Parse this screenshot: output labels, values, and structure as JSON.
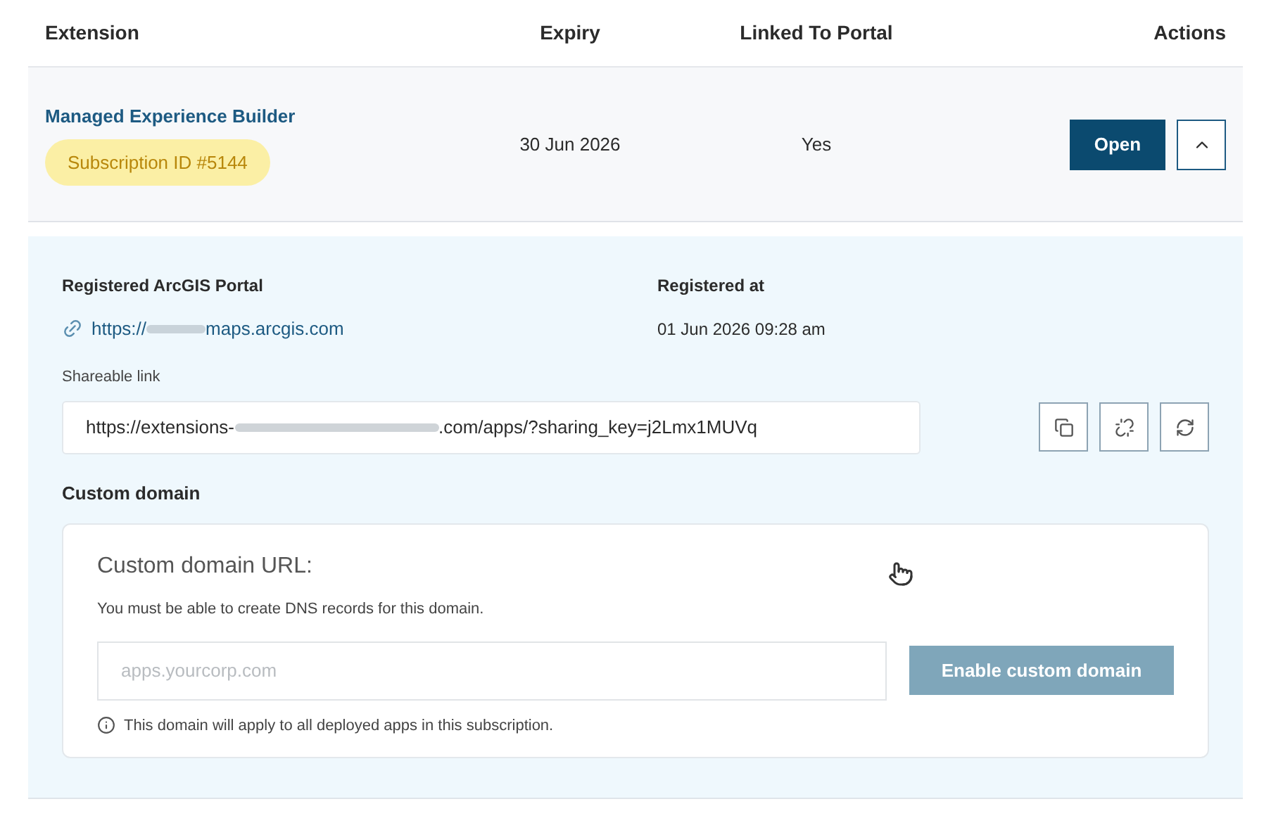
{
  "table": {
    "columns": [
      "Extension",
      "Expiry",
      "Linked To Portal",
      "Actions"
    ],
    "rows": [
      {
        "name": "Managed Experience Builder",
        "subscription": "Subscription ID #5144",
        "expiry": "30 Jun 2026",
        "linked": "Yes",
        "open_button": "Open",
        "expanded": true,
        "details": {
          "portal_label": "Registered ArcGIS Portal",
          "portal_url_start": "https://",
          "portal_url_end": "maps.arcgis.com",
          "registered_label": "Registered at",
          "registered_value": "01 Jun 2026 09:28 am",
          "share_label": "Shareable link",
          "share_url_start": "https://extensions-",
          "share_url_end": ".com/apps/?sharing_key=j2Lmx1MUVq",
          "custom_domain_title": "Custom domain",
          "custom_domain": {
            "heading": "Custom domain URL:",
            "hint": "You must be able to create DNS records for this domain.",
            "placeholder": "apps.yourcorp.com",
            "button": {
              "label": "Enable custom domain",
              "disabled": true
            },
            "note": "This domain will apply to all deployed apps in this subscription."
          }
        }
      }
    ]
  }
}
